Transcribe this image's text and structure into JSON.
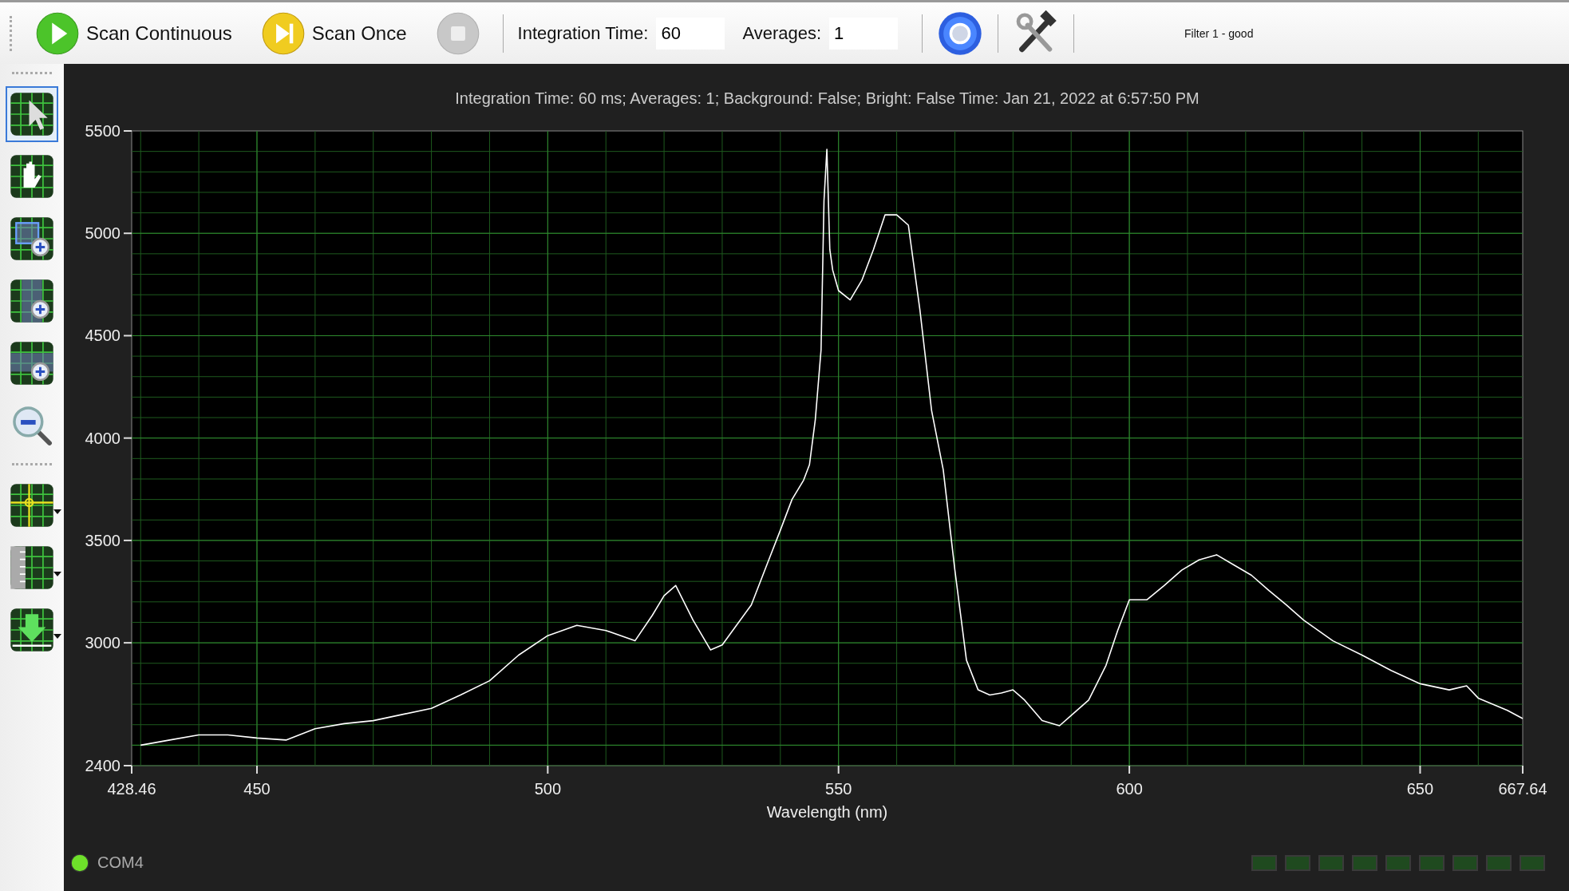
{
  "toolbar": {
    "buttons": [
      {
        "kind": "play",
        "label": "Scan Continuous",
        "disabled": false
      },
      {
        "kind": "step",
        "label": "Scan Once",
        "disabled": false
      },
      {
        "kind": "stop",
        "disabled": true
      }
    ],
    "integration_time": {
      "label": "Integration Time:",
      "value": "60"
    },
    "averages": {
      "label": "Averages:",
      "value": "1"
    },
    "filter_label": "Filter 1 - good"
  },
  "tools": [
    [
      {
        "kind": "pointer",
        "selected": true,
        "has_menu": false
      },
      {
        "kind": "hand",
        "selected": false,
        "has_menu": false
      },
      {
        "kind": "zoom-box",
        "selected": false,
        "has_menu": false
      },
      {
        "kind": "zoom-h",
        "selected": false,
        "has_menu": false
      },
      {
        "kind": "zoom-v",
        "selected": false,
        "has_menu": false
      },
      {
        "kind": "zoom-out",
        "selected": false,
        "has_menu": false
      }
    ],
    [
      {
        "kind": "crosshair",
        "selected": false,
        "has_menu": true
      },
      {
        "kind": "ruler",
        "selected": false,
        "has_menu": true
      },
      {
        "kind": "export",
        "selected": false,
        "has_menu": true
      }
    ]
  ],
  "chart_data": {
    "type": "line",
    "title": "Integration Time: 60 ms; Averages: 1; Background: False; Bright: False Time: Jan 21, 2022 at 6:57:50 PM",
    "xlabel": "Wavelength (nm)",
    "x": [
      430,
      435,
      440,
      445,
      450,
      455,
      460,
      465,
      470,
      475,
      480,
      485,
      490,
      495,
      500,
      505,
      510,
      515,
      518,
      520,
      522,
      525,
      528,
      530,
      535,
      538,
      540,
      542,
      544,
      545,
      546,
      547,
      547.5,
      548,
      548.5,
      549,
      550,
      552,
      554,
      556,
      558,
      560,
      562,
      564,
      566,
      568,
      570,
      572,
      574,
      576,
      578,
      580,
      582,
      585,
      588,
      590,
      593,
      596,
      598,
      600,
      603,
      606,
      609,
      612,
      615,
      618,
      621,
      624,
      627,
      630,
      635,
      640,
      645,
      650,
      655,
      658,
      660,
      665,
      667.64
    ],
    "grid": true,
    "series": [
      {
        "color": "#ffffff",
        "values": [
          2500,
          2525,
          2550,
          2550,
          2535,
          2525,
          2580,
          2605,
          2620,
          2650,
          2680,
          2745,
          2815,
          2940,
          3035,
          3085,
          3060,
          3010,
          3135,
          3230,
          3280,
          3110,
          2965,
          2990,
          3185,
          3405,
          3550,
          3700,
          3795,
          3870,
          4090,
          4430,
          5160,
          5410,
          4920,
          4820,
          4720,
          4675,
          4770,
          4920,
          5090,
          5090,
          5040,
          4625,
          4135,
          3845,
          3355,
          2915,
          2770,
          2745,
          2755,
          2770,
          2720,
          2620,
          2595,
          2645,
          2720,
          2890,
          3060,
          3210,
          3210,
          3280,
          3355,
          3405,
          3430,
          3380,
          3330,
          3255,
          3185,
          3110,
          3010,
          2940,
          2865,
          2800,
          2770,
          2790,
          2730,
          2670,
          2630
        ]
      }
    ],
    "xlim": [
      428.46,
      667.64
    ],
    "ylim": [
      2400,
      5500
    ],
    "xticks": [
      428.46,
      450,
      500,
      550,
      600,
      650,
      667.64
    ],
    "yticks": [
      2400,
      3000,
      3500,
      4000,
      4500,
      5000,
      5500
    ]
  },
  "status": {
    "port": "COM4",
    "connected": true,
    "indicators": [
      {
        "on": false
      },
      {
        "on": false
      },
      {
        "on": false
      },
      {
        "on": false
      },
      {
        "on": false
      },
      {
        "on": false
      },
      {
        "on": false
      },
      {
        "on": false
      },
      {
        "on": false
      }
    ]
  }
}
